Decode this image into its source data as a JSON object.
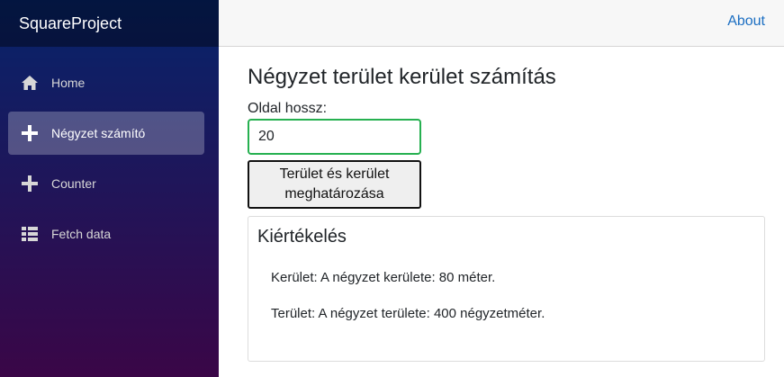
{
  "sidebar": {
    "brand": "SquareProject",
    "items": [
      {
        "label": "Home",
        "icon": "home-icon"
      },
      {
        "label": "Négyzet számító",
        "icon": "plus-icon"
      },
      {
        "label": "Counter",
        "icon": "plus-icon"
      },
      {
        "label": "Fetch data",
        "icon": "list-icon"
      }
    ],
    "active_index": 1
  },
  "topbar": {
    "about_label": "About"
  },
  "main": {
    "title": "Négyzet terület kerület számítás",
    "side_label": "Oldal hossz:",
    "side_value": "20",
    "button_label": "Terület és kerület meghatározása",
    "result": {
      "title": "Kiértékelés",
      "perimeter_text": "Kerület: A négyzet kerülete: 80 méter.",
      "area_text": "Terület: A négyzet területe: 400 négyzetméter."
    }
  },
  "colors": {
    "accent": "#1b6ec2",
    "input_border": "#26b050",
    "sidebar_top": "#06246b",
    "sidebar_bottom": "#3a0647"
  }
}
